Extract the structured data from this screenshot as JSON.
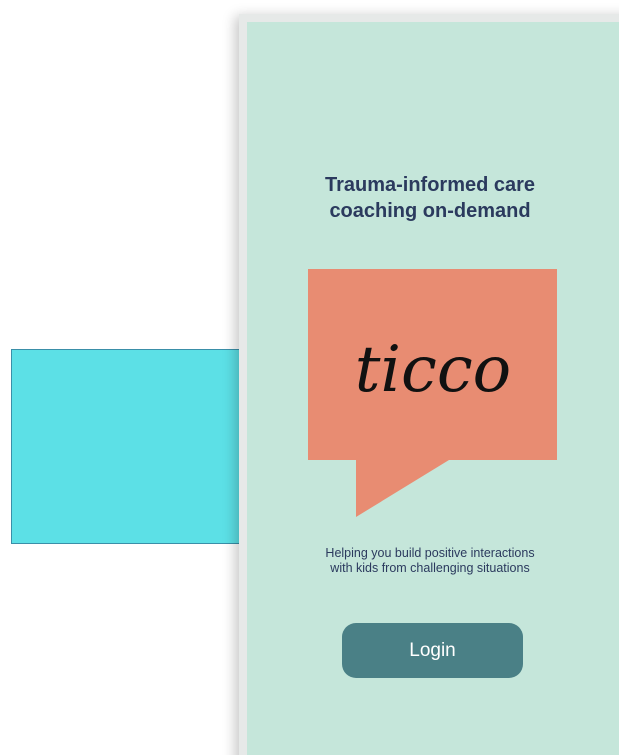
{
  "colors": {
    "cyan_block": "#5ce0e6",
    "screen_background": "#c5e6da",
    "speech_bubble": "#e88c72",
    "button_background": "#4a8086",
    "text_dark": "#2b3a5e"
  },
  "login_screen": {
    "title": "Trauma-informed care\ncoaching on-demand",
    "logo": {
      "wordmark": "ticco",
      "icon": "speech-bubble-icon"
    },
    "tagline": "Helping you build positive interactions\nwith kids from challenging situations",
    "login_label": "Login"
  }
}
